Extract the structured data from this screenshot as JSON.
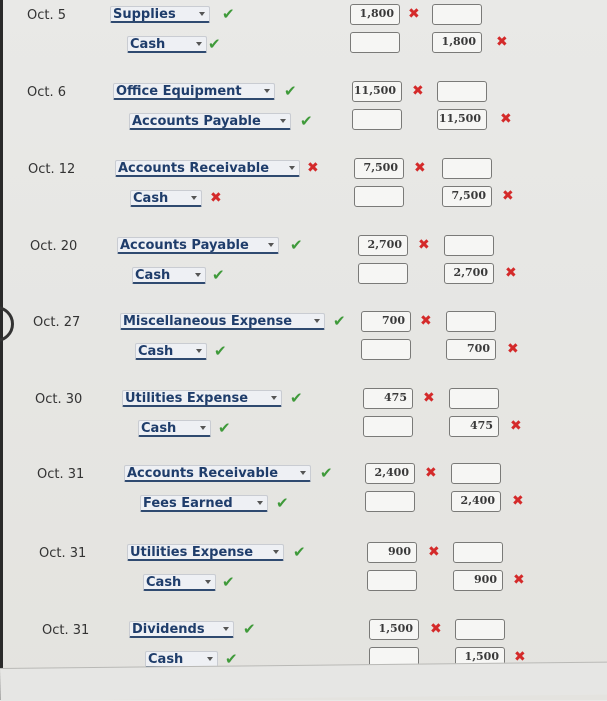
{
  "entries": [
    {
      "date": "Oct. 5",
      "debit": {
        "account": "Supplies",
        "account_status": "correct",
        "amount": "1,800",
        "amount_status": "incorrect"
      },
      "credit": {
        "account": "Cash",
        "account_status": "correct",
        "amount": "1,800",
        "amount_status": "incorrect"
      }
    },
    {
      "date": "Oct. 6",
      "debit": {
        "account": "Office Equipment",
        "account_status": "correct",
        "amount": "11,500",
        "amount_status": "incorrect"
      },
      "credit": {
        "account": "Accounts Payable",
        "account_status": "correct",
        "amount": "11,500",
        "amount_status": "incorrect"
      }
    },
    {
      "date": "Oct. 12",
      "debit": {
        "account": "Accounts Receivable",
        "account_status": "incorrect",
        "amount": "7,500",
        "amount_status": "incorrect"
      },
      "credit": {
        "account": "Cash",
        "account_status": "incorrect",
        "amount": "7,500",
        "amount_status": "incorrect"
      }
    },
    {
      "date": "Oct. 20",
      "debit": {
        "account": "Accounts Payable",
        "account_status": "correct",
        "amount": "2,700",
        "amount_status": "incorrect"
      },
      "credit": {
        "account": "Cash",
        "account_status": "correct",
        "amount": "2,700",
        "amount_status": "incorrect"
      }
    },
    {
      "date": "Oct. 27",
      "debit": {
        "account": "Miscellaneous Expense",
        "account_status": "correct",
        "amount": "700",
        "amount_status": "incorrect"
      },
      "credit": {
        "account": "Cash",
        "account_status": "correct",
        "amount": "700",
        "amount_status": "incorrect"
      }
    },
    {
      "date": "Oct. 30",
      "debit": {
        "account": "Utilities Expense",
        "account_status": "correct",
        "amount": "475",
        "amount_status": "incorrect"
      },
      "credit": {
        "account": "Cash",
        "account_status": "correct",
        "amount": "475",
        "amount_status": "incorrect"
      }
    },
    {
      "date": "Oct. 31",
      "debit": {
        "account": "Accounts Receivable",
        "account_status": "correct",
        "amount": "2,400",
        "amount_status": "incorrect"
      },
      "credit": {
        "account": "Fees Earned",
        "account_status": "correct",
        "amount": "2,400",
        "amount_status": "incorrect"
      }
    },
    {
      "date": "Oct. 31",
      "debit": {
        "account": "Utilities Expense",
        "account_status": "correct",
        "amount": "900",
        "amount_status": "incorrect"
      },
      "credit": {
        "account": "Cash",
        "account_status": "correct",
        "amount": "900",
        "amount_status": "incorrect"
      }
    },
    {
      "date": "Oct. 31",
      "debit": {
        "account": "Dividends",
        "account_status": "correct",
        "amount": "1,500",
        "amount_status": "incorrect"
      },
      "credit": {
        "account": "Cash",
        "account_status": "correct",
        "amount": "1,500",
        "amount_status": "incorrect"
      }
    }
  ],
  "icons": {
    "correct": "checkmark-icon",
    "incorrect": "x-mark-icon"
  },
  "colors": {
    "correct": "#3f9a3a",
    "incorrect": "#d42a2a",
    "account_text": "#1f3d6b"
  }
}
